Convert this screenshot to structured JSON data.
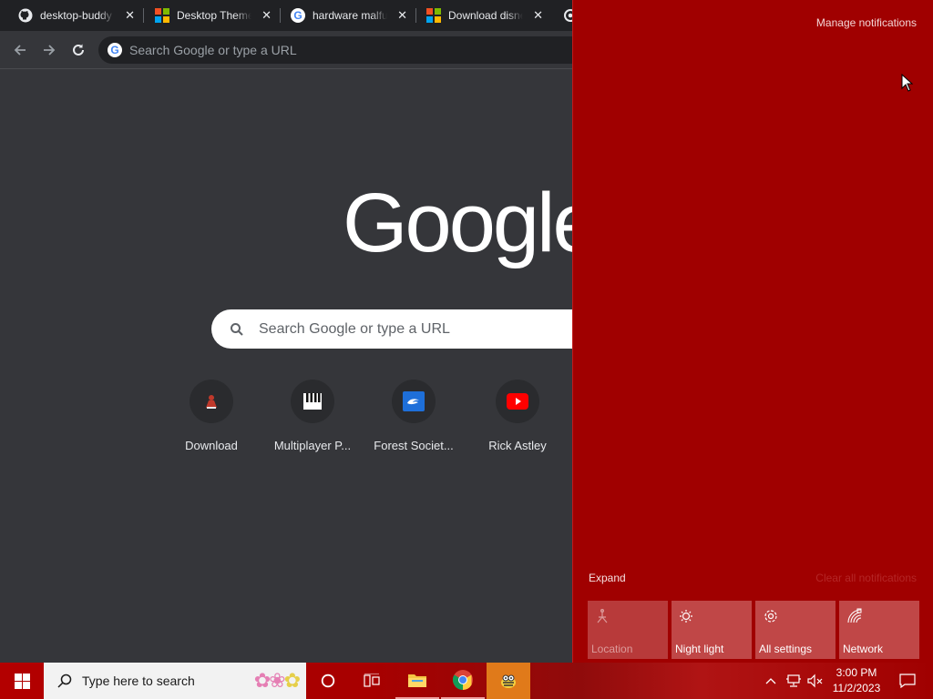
{
  "chrome": {
    "tabs": [
      {
        "title": "desktop-buddy",
        "icon": "github-icon"
      },
      {
        "title": "Desktop Themes",
        "icon": "microsoft-store-icon"
      },
      {
        "title": "hardware malfunction",
        "icon": "google-icon"
      },
      {
        "title": "Download disney",
        "icon": "microsoft-store-icon"
      }
    ],
    "omnibox_placeholder": "Search Google or type a URL",
    "logo_text": "Google",
    "search_placeholder": "Search Google or type a URL",
    "shortcuts": [
      {
        "label": "Download",
        "icon": "red-figure-icon"
      },
      {
        "label": "Multiplayer P...",
        "icon": "piano-keys-icon"
      },
      {
        "label": "Forest Societ...",
        "icon": "forest-society-icon"
      },
      {
        "label": "Rick Astley",
        "icon": "youtube-icon"
      }
    ]
  },
  "action_center": {
    "manage": "Manage notifications",
    "expand": "Expand",
    "clear_all": "Clear all notifications",
    "quick_actions": [
      {
        "label": "Location",
        "icon": "location-icon",
        "state": "off"
      },
      {
        "label": "Night light",
        "icon": "night-light-icon",
        "state": "on"
      },
      {
        "label": "All settings",
        "icon": "gear-icon",
        "state": "on"
      },
      {
        "label": "Network",
        "icon": "network-icon",
        "state": "on"
      }
    ]
  },
  "taskbar": {
    "search_placeholder": "Type here to search",
    "time": "3:00 PM",
    "date": "11/2/2023"
  },
  "colors": {
    "action_center_bg": "#a00000",
    "chrome_bg": "#35363a"
  }
}
